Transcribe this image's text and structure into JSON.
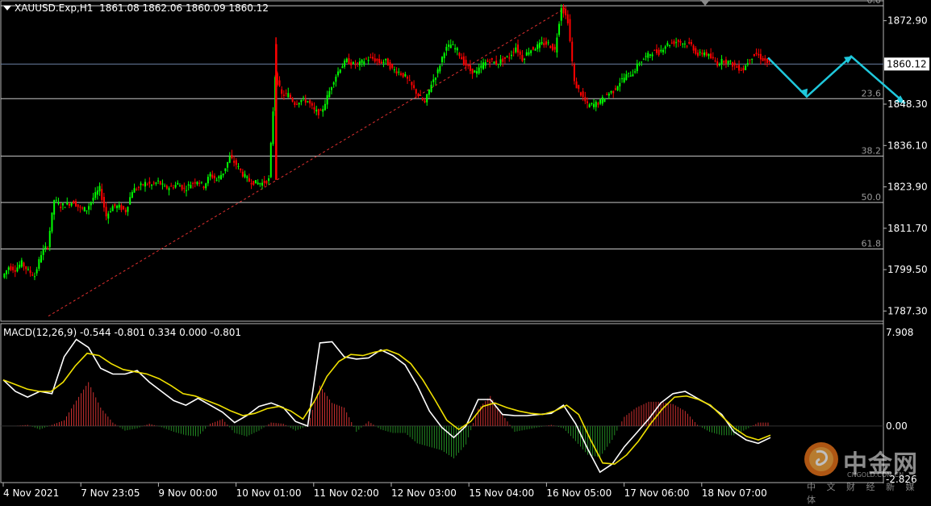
{
  "header": {
    "symbol": "XAUUSD.Exp,H1",
    "ohlc": "1861.08 1862.06 1860.09 1860.12"
  },
  "macd_header": "MACD(12,26,9) -0.544 -0.801 0.334 0.000 -0.801",
  "watermark": {
    "brand": "中金网",
    "site": "CNGOLD.COM.CN",
    "tagline": "中 文 财 经 新 媒 体"
  },
  "colors": {
    "background": "#000000",
    "bull": "#00ff00",
    "bear": "#ff0000",
    "grid": "#c8c8c8",
    "trendline": "#e03030",
    "forecast": "#1fc8dc",
    "macd_line": "#ffffff",
    "signal_line": "#f0e000",
    "hist_pos": "#cc3030",
    "hist_neg": "#228822",
    "current_price_line": "#6a7ea0"
  },
  "chart_data": [
    {
      "type": "candlestick",
      "title": "XAUUSD.Exp,H1",
      "timeframe": "H1",
      "current_price": 1860.12,
      "current_price_label": "1860.12",
      "y_ticks": [
        "1872.90",
        "1860.12",
        "1848.30",
        "1836.10",
        "1823.90",
        "1811.70",
        "1799.50",
        "1787.30"
      ],
      "y_tick_values": [
        1872.9,
        1860.12,
        1848.3,
        1836.1,
        1823.9,
        1811.7,
        1799.5,
        1787.3
      ],
      "ylim": [
        1784.3,
        1879.0
      ],
      "x_ticks": [
        "4 Nov 2021",
        "7 Nov 23:05",
        "9 Nov 00:00",
        "10 Nov 01:00",
        "11 Nov 02:00",
        "12 Nov 03:00",
        "15 Nov 04:00",
        "16 Nov 05:00",
        "17 Nov 06:00",
        "18 Nov 07:00"
      ],
      "fibonacci": {
        "levels": [
          {
            "label": "0.0",
            "price": 1877.3
          },
          {
            "label": "23.6",
            "price": 1849.9
          },
          {
            "label": "38.2",
            "price": 1833.0
          },
          {
            "label": "50.0",
            "price": 1819.3
          },
          {
            "label": "61.8",
            "price": 1805.6
          }
        ]
      },
      "trendline": {
        "from": {
          "x": "4 Nov 2021",
          "price": 1785.8
        },
        "to": {
          "x": "16 Nov 05:00",
          "price": 1876.5
        }
      },
      "forecast_path_prices": [
        1862.0,
        1850.5,
        1862.4,
        1848.5
      ],
      "price_path": [
        1797.2,
        1800.3,
        1799.6,
        1801.5,
        1799.1,
        1797.7,
        1804.2,
        1806.6,
        1820.1,
        1818.2,
        1818.9,
        1819.5,
        1817.4,
        1817.3,
        1820.7,
        1823.4,
        1815.3,
        1818.2,
        1818.0,
        1816.8,
        1822.8,
        1823.8,
        1825.0,
        1824.4,
        1825.4,
        1823.6,
        1823.8,
        1824.8,
        1823.2,
        1824.8,
        1825.8,
        1824.1,
        1827.5,
        1826.0,
        1828.2,
        1832.6,
        1830.5,
        1827.6,
        1825.6,
        1825.1,
        1825.0,
        1826.0,
        1856.7,
        1851.0,
        1851.1,
        1848.6,
        1849.5,
        1849.2,
        1846.3,
        1845.6,
        1850.4,
        1855.5,
        1859.1,
        1861.1,
        1860.0,
        1860.2,
        1861.6,
        1861.7,
        1860.6,
        1861.0,
        1858.6,
        1857.8,
        1856.4,
        1853.6,
        1850.9,
        1848.6,
        1854.4,
        1858.0,
        1864.1,
        1865.8,
        1864.1,
        1860.6,
        1858.2,
        1857.6,
        1860.2,
        1861.2,
        1860.3,
        1861.4,
        1862.3,
        1865.2,
        1861.6,
        1864.1,
        1865.0,
        1866.1,
        1866.1,
        1864.1,
        1877.1,
        1872.9,
        1854.6,
        1851.3,
        1847.9,
        1848.2,
        1849.0,
        1851.2,
        1852.2,
        1854.9,
        1856.7,
        1857.5,
        1860.6,
        1862.2,
        1863.7,
        1863.6,
        1865.7,
        1866.4,
        1866.9,
        1866.1,
        1865.7,
        1862.7,
        1863.6,
        1861.9,
        1860.3,
        1861.3,
        1860.4,
        1859.1,
        1858.6,
        1861.9,
        1863.1,
        1861.5,
        1860.1
      ]
    },
    {
      "type": "line",
      "title": "MACD(12,26,9) -0.544 -0.801 0.334 0.000 -0.801",
      "params": [
        12,
        26,
        9
      ],
      "values": {
        "macd": -0.544,
        "signal": -0.801,
        "osma": 0.334,
        "zero": 0.0,
        "value5": -0.801
      },
      "y_ticks": [
        "7.908",
        "0.00",
        "-2.826"
      ],
      "y_tick_values": [
        7.908,
        0.0,
        -2.826
      ],
      "ylim": [
        -4.9,
        8.8
      ],
      "series": [
        {
          "name": "macd",
          "values": [
            4.0,
            3.0,
            2.5,
            3.0,
            2.8,
            6.0,
            7.5,
            6.8,
            5.0,
            4.5,
            4.5,
            4.8,
            3.8,
            3.0,
            2.2,
            1.8,
            2.4,
            1.8,
            1.2,
            0.3,
            0.9,
            1.7,
            2.0,
            1.6,
            0.4,
            0.0,
            7.2,
            7.3,
            6.0,
            5.8,
            5.9,
            6.6,
            6.1,
            5.3,
            3.5,
            1.3,
            -0.1,
            -1.0,
            0.0,
            2.3,
            2.3,
            1.0,
            0.9,
            0.9,
            1.0,
            1.1,
            1.8,
            0.2,
            -2.0,
            -4.0,
            -3.3,
            -1.8,
            -0.6,
            0.6,
            2.0,
            2.8,
            3.0,
            2.4,
            1.8,
            1.0,
            -0.5,
            -1.2,
            -1.5,
            -1.0
          ]
        },
        {
          "name": "signal",
          "values": [
            4.0,
            3.6,
            3.2,
            3.0,
            3.0,
            3.8,
            5.2,
            6.3,
            6.1,
            5.4,
            4.9,
            4.7,
            4.5,
            4.1,
            3.5,
            2.8,
            2.6,
            2.2,
            1.8,
            1.3,
            0.9,
            1.1,
            1.5,
            1.7,
            1.3,
            0.6,
            2.2,
            4.3,
            5.6,
            6.2,
            6.1,
            6.4,
            6.6,
            6.2,
            5.4,
            4.0,
            2.3,
            0.5,
            -0.3,
            0.4,
            1.7,
            2.0,
            1.6,
            1.3,
            1.1,
            1.0,
            1.3,
            1.8,
            1.0,
            -1.2,
            -3.2,
            -3.3,
            -2.5,
            -1.3,
            0.2,
            1.5,
            2.5,
            2.6,
            2.3,
            1.8,
            0.8,
            -0.2,
            -0.9,
            -1.2,
            -0.8
          ]
        },
        {
          "name": "histogram",
          "values": [
            0.0,
            0.0,
            0.1,
            -0.3,
            0.1,
            0.5,
            2.2,
            3.8,
            1.6,
            0.3,
            -0.4,
            -0.2,
            0.2,
            -0.1,
            -0.5,
            -0.8,
            -0.9,
            0.2,
            0.6,
            -0.6,
            -0.9,
            -0.4,
            0.3,
            0.2,
            -0.4,
            0.0,
            3.5,
            2.0,
            1.6,
            -0.5,
            0.4,
            -0.3,
            -0.6,
            -0.6,
            -1.5,
            -1.8,
            -2.1,
            -2.8,
            -1.6,
            1.5,
            2.6,
            1.0,
            -0.5,
            -0.3,
            -0.1,
            0.1,
            -0.2,
            -1.3,
            -2.5,
            -2.7,
            -1.2,
            0.8,
            1.6,
            2.1,
            2.1,
            1.9,
            1.3,
            0.1,
            -0.5,
            -0.8,
            -0.8,
            -0.3,
            0.3,
            0.3
          ]
        }
      ]
    }
  ]
}
